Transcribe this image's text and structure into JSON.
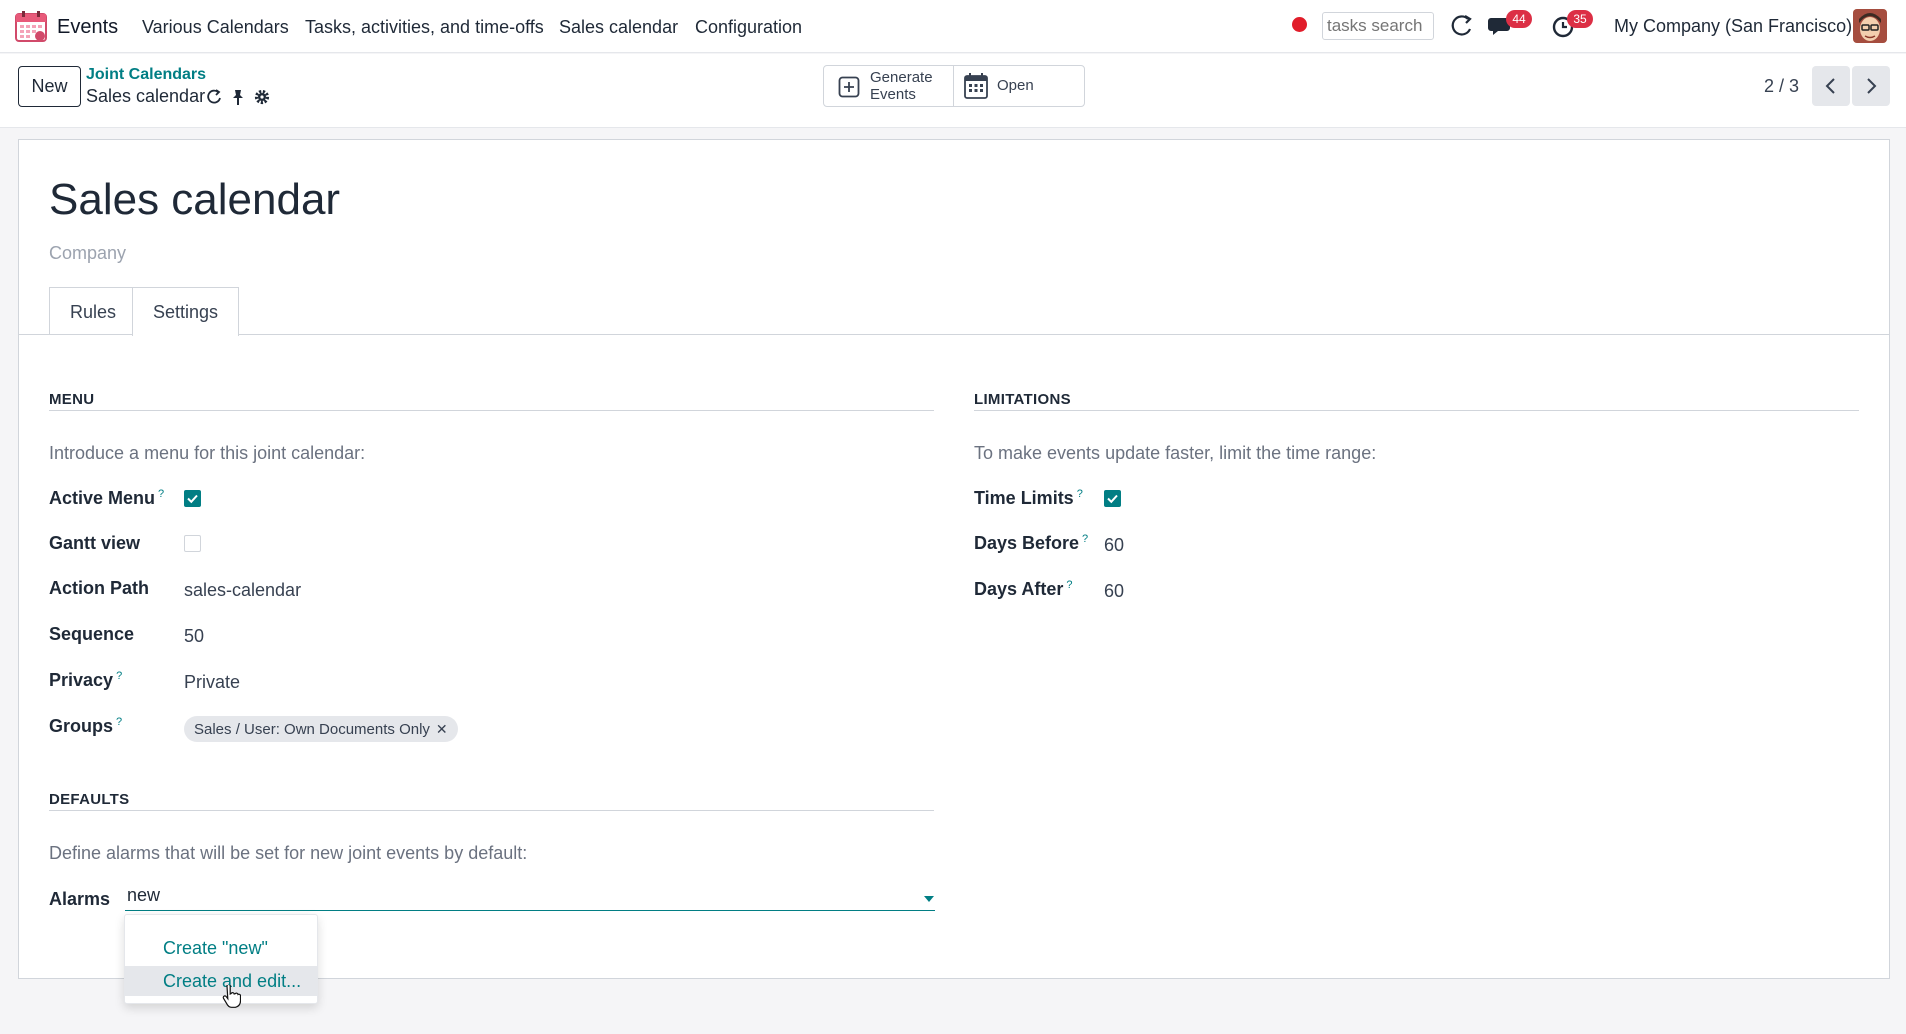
{
  "navbar": {
    "app_name": "Events",
    "menus": [
      "Various Calendars",
      "Tasks, activities, and time-offs",
      "Sales calendar",
      "Configuration"
    ],
    "search_placeholder": "tasks search",
    "messages_count": "44",
    "activities_count": "35",
    "company": "My Company (San Francisco)",
    "icons": [
      "calendar-app-icon",
      "record-icon",
      "refresh-icon",
      "chat-icon",
      "clock-icon",
      "avatar"
    ]
  },
  "control_panel": {
    "new_label": "New",
    "breadcrumb_parent": "Joint Calendars",
    "breadcrumb_current": "Sales calendar",
    "generate_label_1": "Generate",
    "generate_label_2": "Events",
    "open_label": "Open",
    "pager": "2 / 3"
  },
  "form": {
    "title": "Sales calendar",
    "subtitle": "Company",
    "tabs": [
      "Rules",
      "Settings"
    ],
    "active_tab": "Settings",
    "menu_section": {
      "title": "MENU",
      "help": "Introduce a menu for this joint calendar:",
      "active_menu_label": "Active Menu",
      "active_menu": true,
      "gantt_label": "Gantt view",
      "gantt": false,
      "action_path_label": "Action Path",
      "action_path": "sales-calendar",
      "sequence_label": "Sequence",
      "sequence": "50",
      "privacy_label": "Privacy",
      "privacy": "Private",
      "groups_label": "Groups",
      "groups": [
        "Sales / User: Own Documents Only"
      ]
    },
    "limitations_section": {
      "title": "LIMITATIONS",
      "help": "To make events update faster, limit the time range:",
      "time_limits_label": "Time Limits",
      "time_limits": true,
      "days_before_label": "Days Before",
      "days_before": "60",
      "days_after_label": "Days After",
      "days_after": "60"
    },
    "defaults_section": {
      "title": "DEFAULTS",
      "help": "Define alarms that will be set for new joint events by default:",
      "alarms_label": "Alarms",
      "alarms_input": "new",
      "dropdown": [
        "Create \"new\"",
        "Create and edit..."
      ]
    }
  },
  "colors": {
    "accent": "#017e84",
    "badge": "#dc2f45",
    "record": "#e11d2a"
  }
}
